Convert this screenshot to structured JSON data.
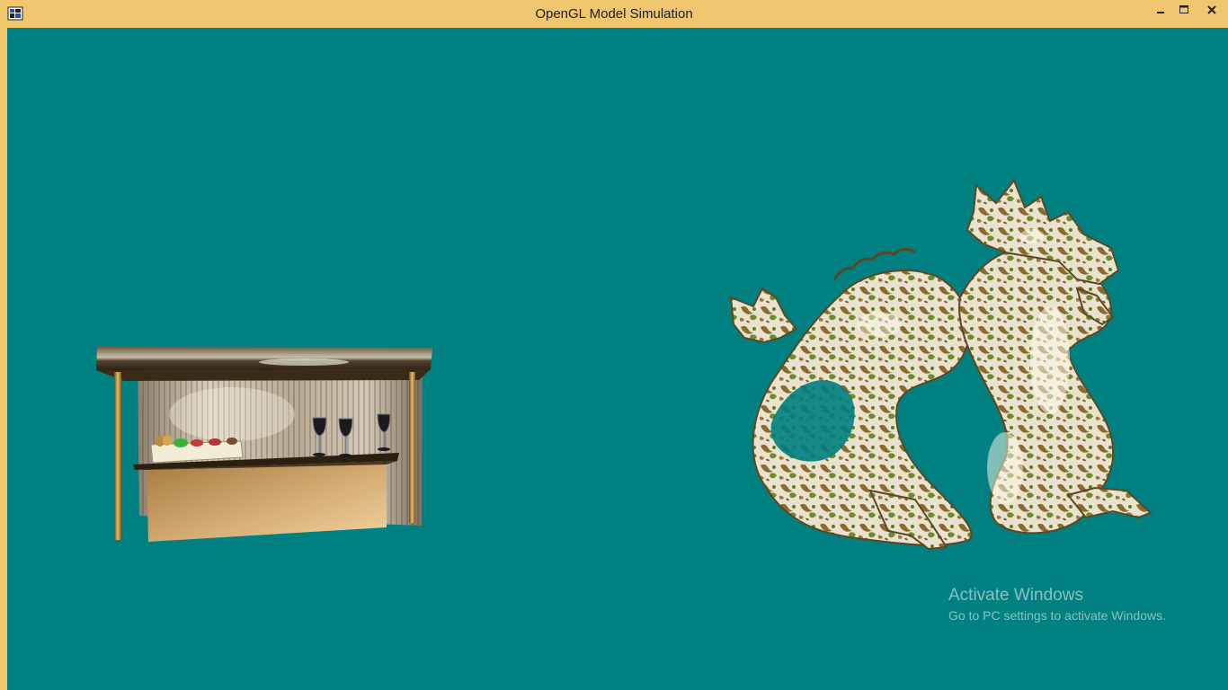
{
  "window": {
    "title": "OpenGL Model Simulation",
    "controls": [
      "minimize-icon",
      "maximize-icon",
      "close-icon"
    ]
  },
  "colors": {
    "titlebar": "#f0c66e",
    "viewport_background": "#008080",
    "gold": "#c9a04a",
    "dark_wood": "#3a2a18"
  },
  "scene": {
    "objects": [
      "bar-counter-model",
      "dragon-model"
    ]
  },
  "watermark": {
    "title": "Activate Windows",
    "subtitle": "Go to PC settings to activate Windows."
  }
}
